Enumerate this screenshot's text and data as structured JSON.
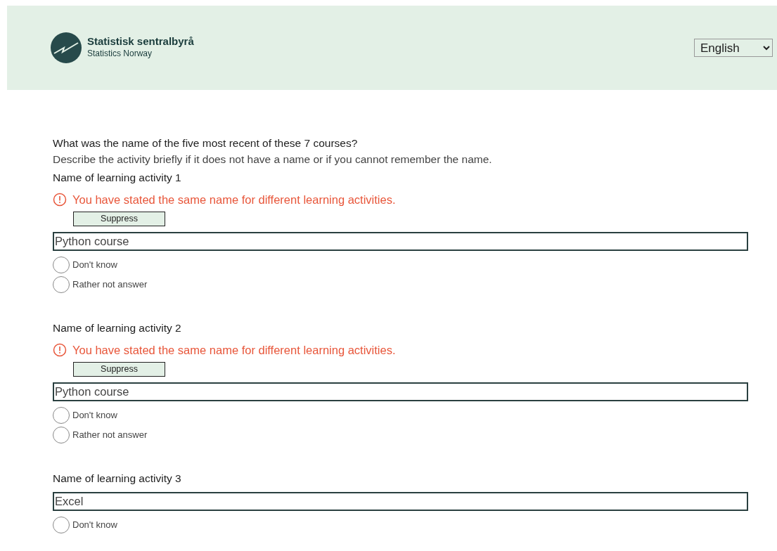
{
  "header": {
    "org_name": "Statistisk sentralbyrå",
    "org_subtitle": "Statistics Norway",
    "language": "English"
  },
  "question": {
    "title": "What was the name of the five most recent of these 7 courses?",
    "description": "Describe the activity briefly if it does not have a name or if you cannot remember the name."
  },
  "activities": [
    {
      "label": "Name of learning activity 1",
      "error": "You have stated the same name for different learning activities.",
      "suppress_label": "Suppress",
      "value": "Python course",
      "options": [
        {
          "label": "Don't know",
          "selected": false
        },
        {
          "label": "Rather not answer",
          "selected": false
        }
      ]
    },
    {
      "label": "Name of learning activity 2",
      "error": "You have stated the same name for different learning activities.",
      "suppress_label": "Suppress",
      "value": "Python course",
      "options": [
        {
          "label": "Don't know",
          "selected": false
        },
        {
          "label": "Rather not answer",
          "selected": false
        }
      ]
    },
    {
      "label": "Name of learning activity 3",
      "value": "Excel",
      "options": [
        {
          "label": "Don't know",
          "selected": false
        }
      ]
    }
  ]
}
